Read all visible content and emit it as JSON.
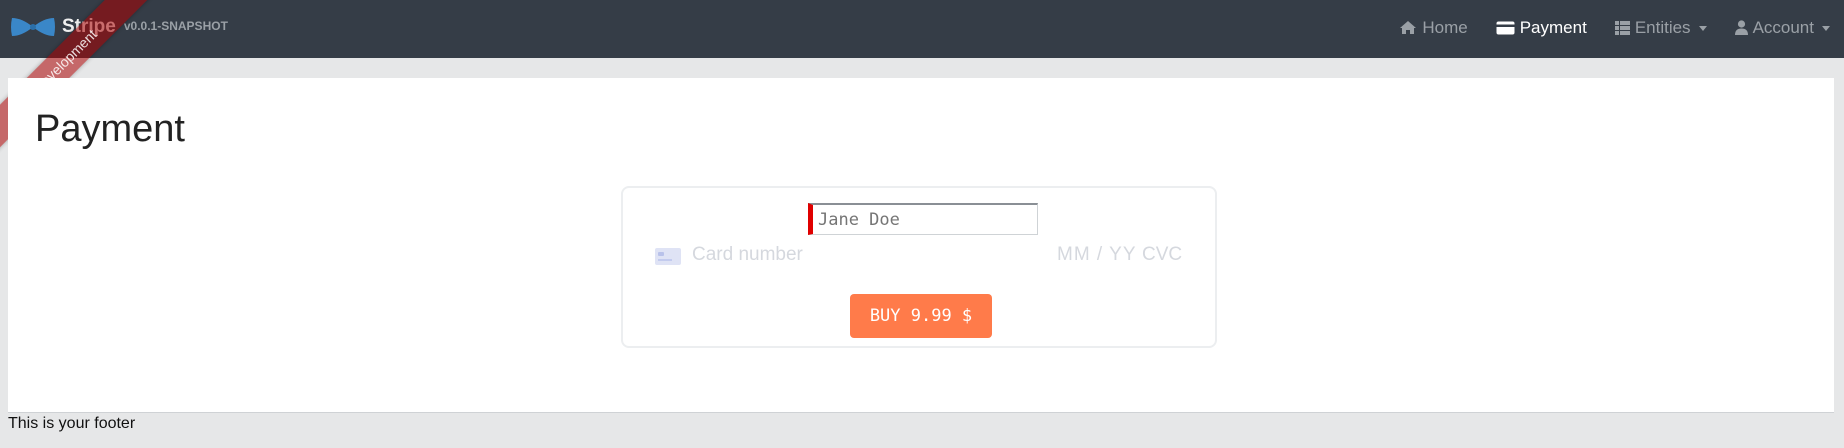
{
  "brand": {
    "title": "Stripe",
    "version": "v0.0.1-SNAPSHOT",
    "logo_icon": "bowtie-logo",
    "ribbon": "Development"
  },
  "nav": {
    "items": [
      {
        "label": "Home",
        "icon": "home-icon",
        "active": false
      },
      {
        "label": "Payment",
        "icon": "credit-card-icon",
        "active": true
      },
      {
        "label": "Entities",
        "icon": "list-icon",
        "active": false,
        "dropdown": true
      },
      {
        "label": "Account",
        "icon": "user-icon",
        "active": false,
        "dropdown": true
      }
    ]
  },
  "page": {
    "title": "Payment"
  },
  "payment": {
    "name_placeholder": "Jane Doe",
    "card_number_placeholder": "Card number",
    "expiry_placeholder": "MM / YY",
    "cvc_placeholder": "CVC",
    "buy_label": "BUY 9.99 $"
  },
  "footer": {
    "text": "This is your footer"
  },
  "colors": {
    "navbar": "#353d47",
    "buy_button": "#ff7b4a",
    "ribbon": "#aa0000"
  }
}
